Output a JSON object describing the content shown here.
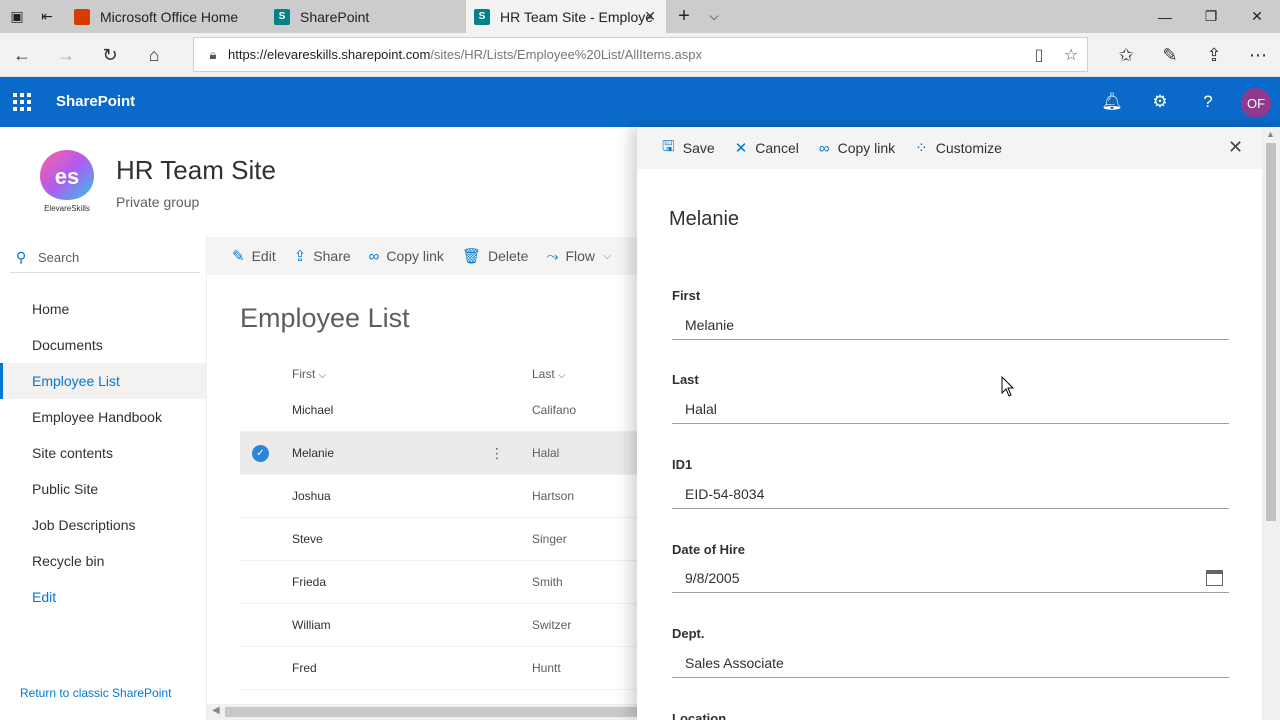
{
  "browser": {
    "tabs": [
      {
        "title": "Microsoft Office Home",
        "favicon_color": "#d83b01",
        "favicon_letter": ""
      },
      {
        "title": "SharePoint",
        "favicon_color": "#038387",
        "favicon_letter": "S"
      },
      {
        "title": "HR Team Site - Employe",
        "favicon_color": "#038387",
        "favicon_letter": "S"
      }
    ],
    "url_host": "https://elevareskills.sharepoint.com",
    "url_path": "/sites/HR/Lists/Employee%20List/AllItems.aspx"
  },
  "suitebar": {
    "brand": "SharePoint",
    "avatar_initials": "OF",
    "accent": "#0b6ac9"
  },
  "site": {
    "logo_text": "es",
    "logo_caption": "ElevareSkills",
    "title": "HR Team Site",
    "subtitle": "Private group"
  },
  "leftnav": {
    "search_placeholder": "Search",
    "items": [
      {
        "label": "Home"
      },
      {
        "label": "Documents"
      },
      {
        "label": "Employee List"
      },
      {
        "label": "Employee Handbook"
      },
      {
        "label": "Site contents"
      },
      {
        "label": "Public Site"
      },
      {
        "label": "Job Descriptions"
      },
      {
        "label": "Recycle bin"
      },
      {
        "label": "Edit"
      }
    ],
    "classic_link": "Return to classic SharePoint"
  },
  "commandbar": {
    "edit": "Edit",
    "share": "Share",
    "copy_link": "Copy link",
    "delete": "Delete",
    "flow": "Flow"
  },
  "list": {
    "title": "Employee List",
    "columns": {
      "first": "First",
      "last": "Last"
    },
    "rows": [
      {
        "first": "Michael",
        "last": "Califano"
      },
      {
        "first": "Melanie",
        "last": "Halal"
      },
      {
        "first": "Joshua",
        "last": "Hartson"
      },
      {
        "first": "Steve",
        "last": "Singer"
      },
      {
        "first": "Frieda",
        "last": "Smith"
      },
      {
        "first": "William",
        "last": "Switzer"
      },
      {
        "first": "Fred",
        "last": "Huntt"
      }
    ]
  },
  "panel": {
    "save": "Save",
    "cancel": "Cancel",
    "copy_link": "Copy link",
    "customize": "Customize",
    "title": "Melanie",
    "fields": [
      {
        "label": "First",
        "value": "Melanie"
      },
      {
        "label": "Last",
        "value": "Halal"
      },
      {
        "label": "ID1",
        "value": "EID-54-8034"
      },
      {
        "label": "Date of Hire",
        "value": "9/8/2005"
      },
      {
        "label": "Dept.",
        "value": "Sales Associate"
      },
      {
        "label": "Location",
        "value": ""
      }
    ]
  }
}
